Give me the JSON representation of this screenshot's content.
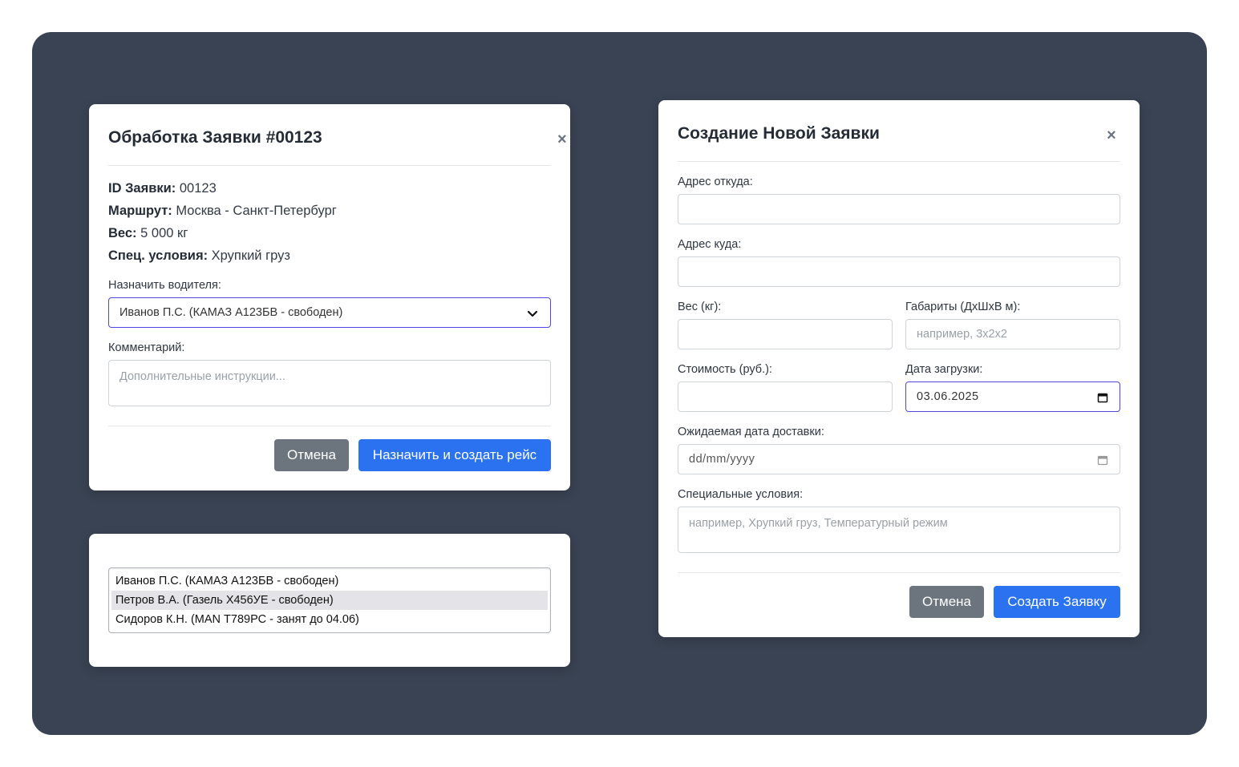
{
  "process_modal": {
    "title": "Обработка Заявки #00123",
    "close": "×",
    "info": [
      {
        "label": "ID Заявки:",
        "value": "00123"
      },
      {
        "label": "Маршрут:",
        "value": "Москва - Санкт-Петербург"
      },
      {
        "label": "Вес:",
        "value": "5 000 кг"
      },
      {
        "label": "Спец. условия:",
        "value": "Хрупкий груз"
      }
    ],
    "driver_label": "Назначить водителя:",
    "driver_selected": "Иванов П.С. (КАМАЗ А123БВ - свободен)",
    "comment_label": "Комментарий:",
    "comment_placeholder": "Дополнительные инструкции...",
    "cancel": "Отмена",
    "submit": "Назначить и создать рейс"
  },
  "driver_list": {
    "options": [
      "Иванов П.С. (КАМАЗ А123БВ - свободен)",
      "Петров В.А. (Газель Х456УЕ - свободен)",
      "Сидоров К.Н. (MAN Т789РС - занят до 04.06)"
    ],
    "highlighted_index": 1
  },
  "create_modal": {
    "title": "Создание Новой Заявки",
    "close": "×",
    "from_label": "Адрес откуда:",
    "to_label": "Адрес куда:",
    "weight_label": "Вес (кг):",
    "dims_label": "Габариты (ДхШхВ м):",
    "dims_placeholder": "например, 3x2x2",
    "cost_label": "Стоимость (руб.):",
    "load_date_label": "Дата загрузки:",
    "load_date_value": "03.06.2025",
    "delivery_label": "Ожидаемая дата доставки:",
    "delivery_placeholder": "dd/mm/yyyy",
    "special_label": "Специальные условия:",
    "special_placeholder": "например, Хрупкий груз, Температурный режим",
    "cancel": "Отмена",
    "submit": "Создать Заявку"
  }
}
